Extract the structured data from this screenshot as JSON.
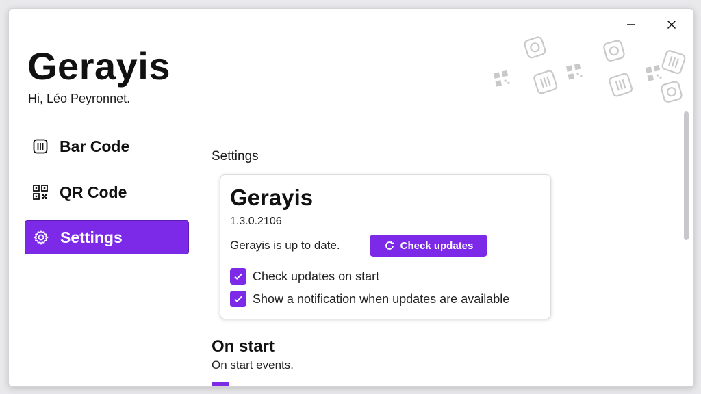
{
  "window": {
    "controls": {
      "minimize_icon": "minimize-icon",
      "close_icon": "close-icon"
    }
  },
  "header": {
    "app_title": "Gerayis",
    "greeting": "Hi, Léo Peyronnet."
  },
  "sidebar": {
    "items": [
      {
        "label": "Bar Code",
        "icon": "barcode-icon",
        "active": false
      },
      {
        "label": "QR Code",
        "icon": "qrcode-icon",
        "active": false
      },
      {
        "label": "Settings",
        "icon": "gear-icon",
        "active": true
      }
    ]
  },
  "main": {
    "section_title": "Settings",
    "about_card": {
      "title": "Gerayis",
      "version": "1.3.0.2106",
      "status": "Gerayis is up to date.",
      "check_button_label": "Check updates",
      "check_button_icon": "refresh-icon",
      "options": [
        {
          "label": "Check updates on start",
          "checked": true
        },
        {
          "label": "Show a notification when updates are available",
          "checked": true
        }
      ]
    },
    "on_start": {
      "title": "On start",
      "description": "On start events."
    }
  },
  "colors": {
    "accent": "#7c2ae8",
    "accent_border": "#5c1bb5",
    "text": "#111111",
    "background": "#ffffff"
  }
}
